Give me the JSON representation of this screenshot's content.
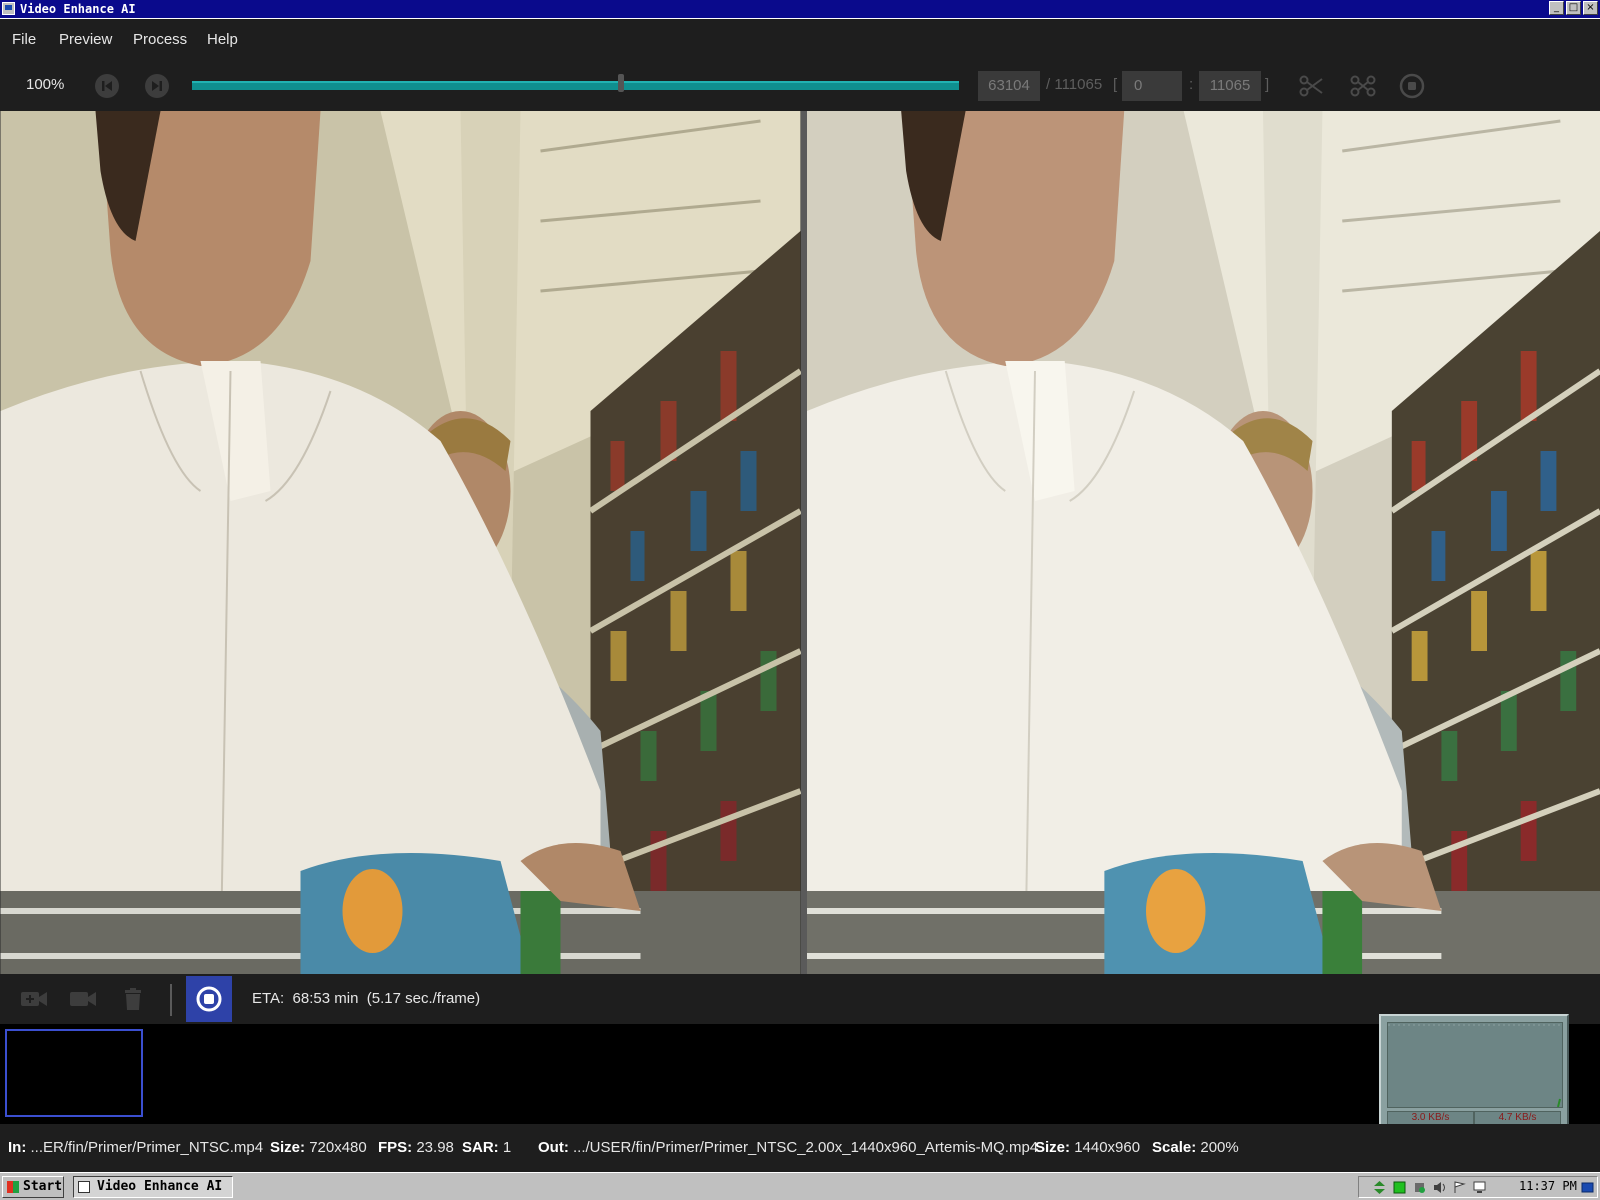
{
  "window": {
    "title": "Video Enhance AI",
    "min": "_",
    "max": "□",
    "close": "×"
  },
  "menu": {
    "file": "File",
    "preview": "Preview",
    "process": "Process",
    "help": "Help"
  },
  "toolbar": {
    "zoom": "100%",
    "frame_current": "63104",
    "frame_total": "/ 111065",
    "range_open": "[",
    "range_start": "0",
    "range_sep": ":",
    "range_end": "11065",
    "range_close": "]",
    "timeline_position": 0.56
  },
  "controls": {
    "eta": "ETA:  68:53 min  (5.17 sec./frame)"
  },
  "network": {
    "download": "3.0 KB/s",
    "upload": "4.7 KB/s"
  },
  "status": {
    "in_label": "In:",
    "in_value": "...ER/fin/Primer/Primer_NTSC.mp4",
    "size_label": "Size:",
    "size_value": "720x480",
    "fps_label": "FPS:",
    "fps_value": "23.98",
    "sar_label": "SAR:",
    "sar_value": "1",
    "out_label": "Out:",
    "out_value": ".../USER/fin/Primer/Primer_NTSC_2.00x_1440x960_Artemis-MQ.mp4",
    "out_size_label": "Size:",
    "out_size_value": "1440x960",
    "scale_label": "Scale:",
    "scale_value": "200%"
  },
  "taskbar": {
    "start": "Start",
    "task": "Video Enhance AI",
    "clock": "11:37 PM"
  },
  "colors": {
    "accent": "#2e42a8",
    "timeline": "#0f8f8f",
    "titlebar": "#0a0a8c"
  }
}
